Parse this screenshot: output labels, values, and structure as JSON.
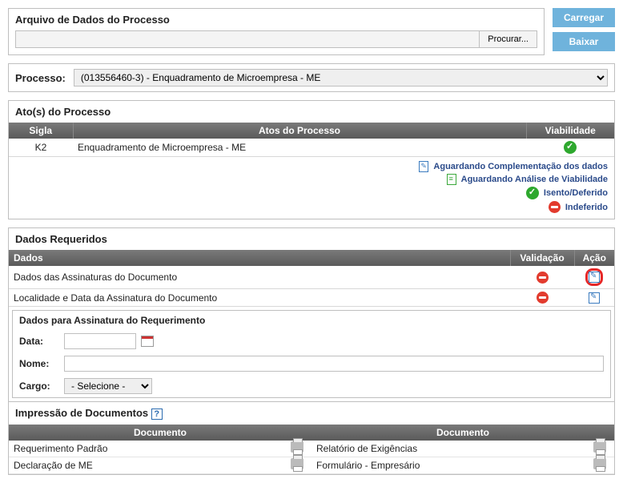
{
  "upload": {
    "title": "Arquivo de Dados do Processo",
    "browse": "Procurar...",
    "carregar": "Carregar",
    "baixar": "Baixar"
  },
  "processo": {
    "label": "Processo:",
    "selected": "(013556460-3) - Enquadramento de Microempresa - ME"
  },
  "atos": {
    "title": "Ato(s) do Processo",
    "col_sigla": "Sigla",
    "col_atos": "Atos do Processo",
    "col_viab": "Viabilidade",
    "rows": [
      {
        "sigla": "K2",
        "ato": "Enquadramento de Microempresa - ME",
        "viab": "ok"
      }
    ],
    "legend": {
      "l1": "Aguardando Complementação dos dados",
      "l2": "Aguardando Análise de Viabilidade",
      "l3": "Isento/Deferido",
      "l4": "Indeferido"
    }
  },
  "dados": {
    "title": "Dados Requeridos",
    "col_dados": "Dados",
    "col_valid": "Validação",
    "col_acao": "Ação",
    "rows": [
      {
        "label": "Dados das Assinaturas do Documento"
      },
      {
        "label": "Localidade e Data da Assinatura do Documento"
      }
    ]
  },
  "assinatura": {
    "title": "Dados para Assinatura do Requerimento",
    "data_label": "Data:",
    "nome_label": "Nome:",
    "cargo_label": "Cargo:",
    "cargo_selected": "- Selecione -"
  },
  "impressao": {
    "title": "Impressão de Documentos",
    "col_doc": "Documento",
    "rows": [
      {
        "left": "Requerimento Padrão",
        "right": "Relatório de Exigências"
      },
      {
        "left": "Declaração de ME",
        "right": "Formulário - Empresário"
      }
    ]
  }
}
